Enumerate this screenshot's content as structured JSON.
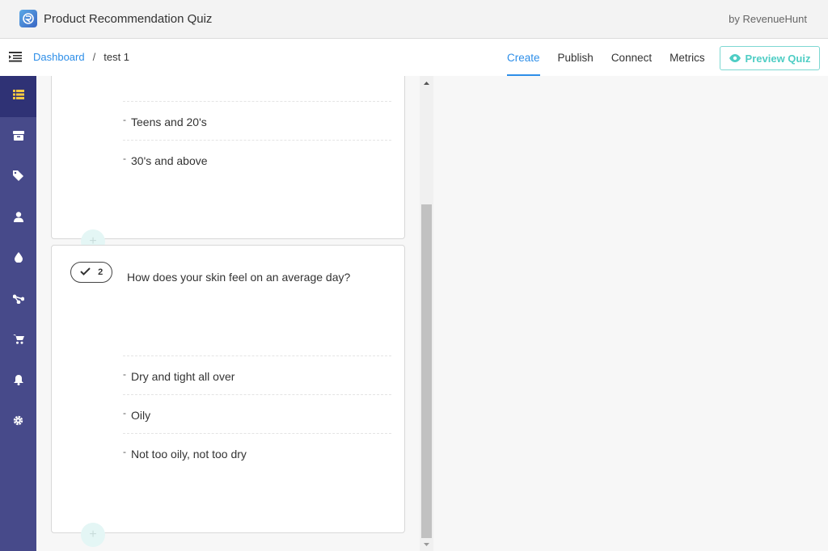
{
  "app": {
    "title": "Product Recommendation Quiz",
    "by": "by RevenueHunt"
  },
  "breadcrumb": {
    "root": "Dashboard",
    "separator": "/",
    "current": "test 1"
  },
  "tabs": [
    {
      "label": "Create",
      "active": true
    },
    {
      "label": "Publish",
      "active": false
    },
    {
      "label": "Connect",
      "active": false
    },
    {
      "label": "Metrics",
      "active": false
    }
  ],
  "preview": {
    "label": "Preview Quiz"
  },
  "sidebar": {
    "items": [
      {
        "icon": "list-icon",
        "active": true
      },
      {
        "icon": "box-icon",
        "active": false
      },
      {
        "icon": "tag-icon",
        "active": false
      },
      {
        "icon": "user-icon",
        "active": false
      },
      {
        "icon": "drop-icon",
        "active": false
      },
      {
        "icon": "branch-icon",
        "active": false
      },
      {
        "icon": "cart-icon",
        "active": false
      },
      {
        "icon": "bell-icon",
        "active": false
      },
      {
        "icon": "gear-icon",
        "active": false
      }
    ]
  },
  "questions": [
    {
      "answers": [
        "Teens and 20's",
        "30's and above"
      ]
    },
    {
      "number": "2",
      "text": "How does your skin feel on an average day?",
      "answers": [
        "Dry and tight all over",
        "Oily",
        "Not too oily, not too dry"
      ]
    }
  ],
  "colors": {
    "accent": "#2d8ee8",
    "sidebar": "#474a8a",
    "sidebar_active": "#2f3275",
    "preview": "#4ecdc4",
    "active_icon": "#f5c842"
  }
}
